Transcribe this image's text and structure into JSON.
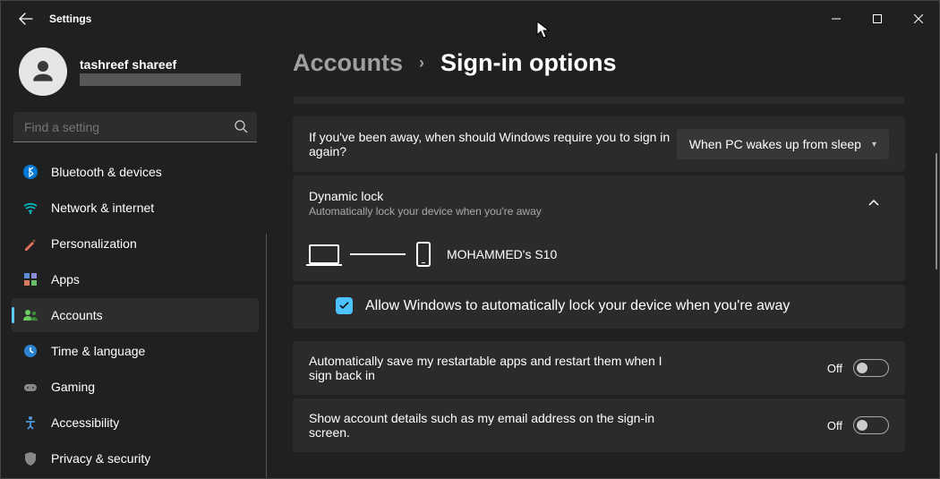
{
  "window": {
    "title": "Settings"
  },
  "user": {
    "name": "tashreef shareef"
  },
  "search": {
    "placeholder": "Find a setting"
  },
  "nav": [
    {
      "key": "bluetooth",
      "label": "Bluetooth & devices",
      "color": "#0078d4"
    },
    {
      "key": "network",
      "label": "Network & internet",
      "color": "#00b7c3"
    },
    {
      "key": "personal",
      "label": "Personalization",
      "color": "#e3735e"
    },
    {
      "key": "apps",
      "label": "Apps",
      "color": "#8b8bd8"
    },
    {
      "key": "accounts",
      "label": "Accounts",
      "color": "#6ccb5f"
    },
    {
      "key": "time",
      "label": "Time & language",
      "color": "#2a83d0"
    },
    {
      "key": "gaming",
      "label": "Gaming",
      "color": "#888"
    },
    {
      "key": "access",
      "label": "Accessibility",
      "color": "#5096d8"
    },
    {
      "key": "privacy",
      "label": "Privacy & security",
      "color": "#888"
    }
  ],
  "breadcrumb": {
    "parent": "Accounts",
    "current": "Sign-in options"
  },
  "away": {
    "question": "If you've been away, when should Windows require you to sign in again?",
    "selected": "When PC wakes up from sleep"
  },
  "dynlock": {
    "title": "Dynamic lock",
    "subtitle": "Automatically lock your device when you're away",
    "device": "MOHAMMED's S10",
    "checkbox": "Allow Windows to automatically lock your device when you're away"
  },
  "restart": {
    "label": "Automatically save my restartable apps and restart them when I sign back in",
    "state": "Off"
  },
  "details": {
    "label": "Show account details such as my email address on the sign-in screen.",
    "state": "Off"
  }
}
